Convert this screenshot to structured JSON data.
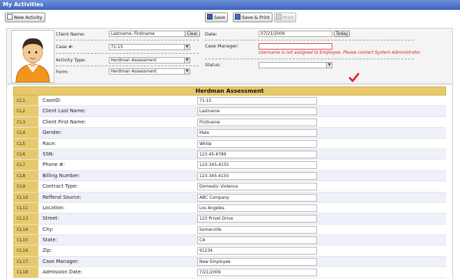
{
  "window": {
    "title": "My Activities"
  },
  "toolbar": {
    "new_activity": "New Activity",
    "save": "Save",
    "save_print": "Save & Print",
    "print": "Print"
  },
  "header": {
    "client_name": {
      "label": "Client Name:",
      "value": "Lastname, Firstname",
      "clear": "Clear"
    },
    "case_no": {
      "label": "Case #:",
      "value": "71-15"
    },
    "activity_type": {
      "label": "Activity Type:",
      "value": "Herdman Assessment"
    },
    "form": {
      "label": "Form:",
      "value": "Herdman Assessment"
    },
    "date": {
      "label": "Date:",
      "value": "07/21/2009",
      "today": "Today"
    },
    "case_manager": {
      "label": "Case Manager:",
      "value": "",
      "error": "Username is not assigned to Employee. Please contact System Administrator"
    },
    "status": {
      "label": "Status:",
      "value": ""
    }
  },
  "form_section": {
    "title": "Herdman Assessment",
    "rows": [
      {
        "code": "CL1",
        "label": "CaseID:",
        "value": "71-15"
      },
      {
        "code": "CL2",
        "label": "Client Last Name:",
        "value": "Lastname"
      },
      {
        "code": "CL3",
        "label": "Client First Name:",
        "value": "Firstname"
      },
      {
        "code": "CL4",
        "label": "Gender:",
        "value": "Male"
      },
      {
        "code": "CL5",
        "label": "Race:",
        "value": "White"
      },
      {
        "code": "CL6",
        "label": "SSN:",
        "value": "123-45-6789"
      },
      {
        "code": "CL7",
        "label": "Phone #:",
        "value": "123-345-4155"
      },
      {
        "code": "CL8",
        "label": "Billing Number:",
        "value": "123-345-4155"
      },
      {
        "code": "CL9",
        "label": "Contract Type:",
        "value": "Domestic Violence"
      },
      {
        "code": "CL10",
        "label": "Refferal Source:",
        "value": "ABC Company"
      },
      {
        "code": "CL11",
        "label": "Location:",
        "value": "Los Angeles"
      },
      {
        "code": "CL13",
        "label": "Street:",
        "value": "123 Privet Drive"
      },
      {
        "code": "CL14",
        "label": "City:",
        "value": "Somerville"
      },
      {
        "code": "CL15",
        "label": "State:",
        "value": "CA"
      },
      {
        "code": "CL16",
        "label": "Zip:",
        "value": "91234"
      },
      {
        "code": "CL17",
        "label": "Case Manager:",
        "value": "New Employee"
      },
      {
        "code": "CL18",
        "label": "Admission Date:",
        "value": "7/21/2009"
      }
    ]
  },
  "icons": {
    "avatar": "person-avatar-icon",
    "check": "check-icon",
    "dropdown": "chevron-down-icon"
  },
  "colors": {
    "titlebar": "#4f74cc",
    "row_code_bg": "#e7c96b",
    "alt_row": "#eef0fa",
    "error": "#d21e1e",
    "check": "#e3263b"
  }
}
